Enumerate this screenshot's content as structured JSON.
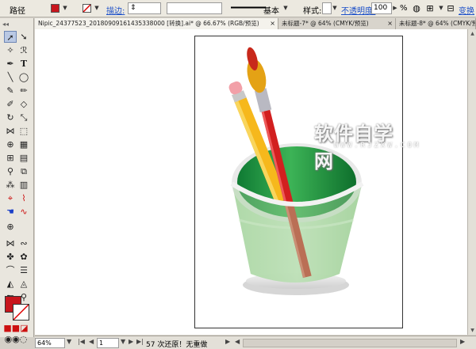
{
  "control_bar": {
    "title": "路径",
    "fill_color": "#c8161d",
    "stroke_label": "描边:",
    "stroke_profile": "基本",
    "style_label": "样式:",
    "opacity_label": "不透明度:",
    "opacity_value": "100",
    "opacity_unit": "%",
    "transform_link": "变换"
  },
  "tabs": [
    {
      "label": "Nipic_24377523_20180909161435338000 [转换].ai* @ 66.67% (RGB/预览)",
      "close": "×"
    },
    {
      "label": "未标题-7* @ 64% (CMYK/预览)",
      "close": "×"
    },
    {
      "label": "未标题-8* @ 64% (CMYK/预览)",
      "close": "×"
    }
  ],
  "watermark": {
    "text": "软件自学网",
    "url": "WWW.RJZXW.COM"
  },
  "status_bar": {
    "zoom": "64%",
    "page": "1",
    "message": "57 次还原！无重做"
  },
  "colors": {
    "fill": "#c8161d",
    "cup_green": "#2e9b4a",
    "pencil_yellow": "#f6b81c",
    "brush_red": "#d21f1f"
  }
}
